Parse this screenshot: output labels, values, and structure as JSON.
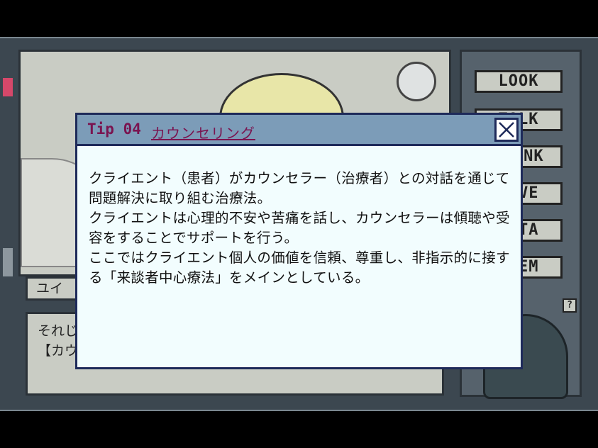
{
  "side_menu": {
    "buttons": [
      "LOOK",
      "TALK",
      "THINK",
      "MOVE",
      "DATA",
      "ITEM"
    ],
    "help_label": "?"
  },
  "dialogue": {
    "speaker": "ユイ",
    "lines": [
      "それじ",
      "【カウ"
    ]
  },
  "tip_dialog": {
    "tip_number": "Tip 04",
    "title": "カウンセリング",
    "close_icon": "close-x-icon",
    "body_lines": [
      "クライエント（患者）がカウンセラー（治療者）との対話を通じて",
      "問題解決に取り組む治療法。",
      "クライエントは心理的不安や苦痛を話し、カウンセラーは傾聴や受",
      "容をすることでサポートを行う。",
      "ここではクライエント個人の価値を信頼、尊重し、非指示的に接す",
      "る「来談者中心療法」をメインとしている。"
    ]
  },
  "colors": {
    "titlebar": "#7c9cb8",
    "title_text": "#7a1450",
    "dialog_bg": "#f2fdfe",
    "border": "#1e2a5a"
  }
}
